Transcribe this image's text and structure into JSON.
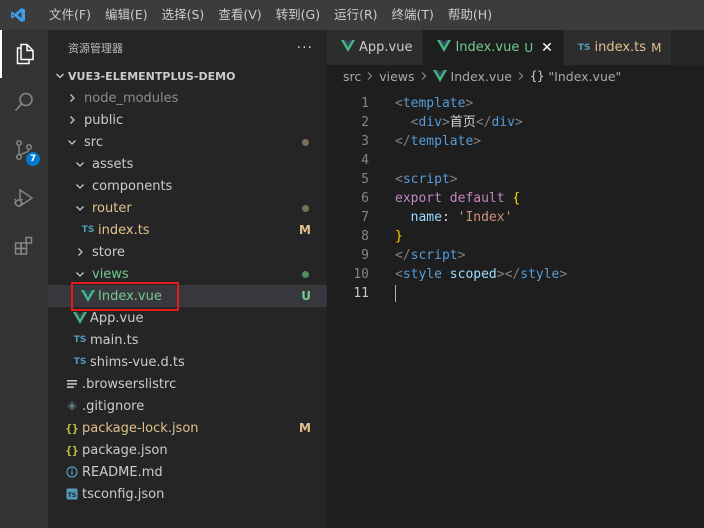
{
  "menu": [
    "文件(F)",
    "编辑(E)",
    "选择(S)",
    "查看(V)",
    "转到(G)",
    "运行(R)",
    "终端(T)",
    "帮助(H)"
  ],
  "activity": {
    "scm_badge": "7"
  },
  "sidebar": {
    "title": "资源管理器",
    "more": "···",
    "root": "VUE3-ELEMENTPLUS-DEMO",
    "items": [
      {
        "label": "node_modules",
        "chev": "right",
        "indent": 1,
        "icon": "",
        "color": "dim",
        "status": "",
        "dot": ""
      },
      {
        "label": "public",
        "chev": "right",
        "indent": 1,
        "icon": "",
        "color": "default",
        "status": "",
        "dot": ""
      },
      {
        "label": "src",
        "chev": "down",
        "indent": 1,
        "icon": "",
        "color": "default",
        "status": "",
        "dot": "#7b6e5b"
      },
      {
        "label": "assets",
        "chev": "down",
        "indent": 2,
        "icon": "",
        "color": "default",
        "status": "",
        "dot": ""
      },
      {
        "label": "components",
        "chev": "down",
        "indent": 2,
        "icon": "",
        "color": "default",
        "status": "",
        "dot": ""
      },
      {
        "label": "router",
        "chev": "down",
        "indent": 2,
        "icon": "",
        "color": "mod",
        "status": "",
        "dot": "#7b6e5b"
      },
      {
        "label": "index.ts",
        "chev": "",
        "indent": 3,
        "icon": "TS",
        "color": "mod",
        "status": "M",
        "dot": ""
      },
      {
        "label": "store",
        "chev": "right",
        "indent": 2,
        "icon": "",
        "color": "default",
        "status": "",
        "dot": ""
      },
      {
        "label": "views",
        "chev": "down",
        "indent": 2,
        "icon": "",
        "color": "new",
        "status": "",
        "dot": "#4e8e5c"
      },
      {
        "label": "Index.vue",
        "chev": "",
        "indent": 3,
        "icon": "vue",
        "color": "new",
        "status": "U",
        "dot": "",
        "selected": true
      },
      {
        "label": "App.vue",
        "chev": "",
        "indent": 2,
        "icon": "vue",
        "color": "default",
        "status": "",
        "dot": ""
      },
      {
        "label": "main.ts",
        "chev": "",
        "indent": 2,
        "icon": "TS",
        "color": "default",
        "status": "",
        "dot": ""
      },
      {
        "label": "shims-vue.d.ts",
        "chev": "",
        "indent": 2,
        "icon": "TS",
        "color": "default",
        "status": "",
        "dot": ""
      },
      {
        "label": ".browserslistrc",
        "chev": "",
        "indent": 1,
        "icon": "list",
        "color": "default",
        "status": "",
        "dot": ""
      },
      {
        "label": ".gitignore",
        "chev": "",
        "indent": 1,
        "icon": "git",
        "color": "default",
        "status": "",
        "dot": ""
      },
      {
        "label": "package-lock.json",
        "chev": "",
        "indent": 1,
        "icon": "{}",
        "color": "mod",
        "status": "M",
        "dot": ""
      },
      {
        "label": "package.json",
        "chev": "",
        "indent": 1,
        "icon": "{}",
        "color": "default",
        "status": "",
        "dot": ""
      },
      {
        "label": "README.md",
        "chev": "",
        "indent": 1,
        "icon": "info",
        "color": "default",
        "status": "",
        "dot": ""
      },
      {
        "label": "tsconfig.json",
        "chev": "",
        "indent": 1,
        "icon": "tsbox",
        "color": "default",
        "status": "",
        "dot": ""
      }
    ]
  },
  "tabs": [
    {
      "label": "App.vue",
      "icon": "vue",
      "status": "",
      "active": false,
      "color": "default"
    },
    {
      "label": "Index.vue",
      "icon": "vue",
      "status": "U",
      "active": true,
      "color": "new",
      "close": "✕"
    },
    {
      "label": "index.ts",
      "icon": "TS",
      "status": "M",
      "active": false,
      "color": "mod"
    }
  ],
  "breadcrumbs": {
    "parts": [
      "src",
      "views",
      "Index.vue",
      "\"Index.vue\""
    ],
    "object_icon": "{}"
  },
  "code": {
    "current_line": 11,
    "lines": [
      [
        [
          "t-br",
          "<"
        ],
        [
          "t-tag",
          "template"
        ],
        [
          "t-br",
          ">"
        ]
      ],
      [
        [
          "t-plain",
          "  "
        ],
        [
          "t-br",
          "<"
        ],
        [
          "t-tag",
          "div"
        ],
        [
          "t-br",
          ">"
        ],
        [
          "t-plain",
          "首页"
        ],
        [
          "t-br",
          "</"
        ],
        [
          "t-tag",
          "div"
        ],
        [
          "t-br",
          ">"
        ]
      ],
      [
        [
          "t-br",
          "</"
        ],
        [
          "t-tag",
          "template"
        ],
        [
          "t-br",
          ">"
        ]
      ],
      [],
      [
        [
          "t-br",
          "<"
        ],
        [
          "t-tag",
          "script"
        ],
        [
          "t-br",
          ">"
        ]
      ],
      [
        [
          "t-kw",
          "export"
        ],
        [
          "t-plain",
          " "
        ],
        [
          "t-kw",
          "default"
        ],
        [
          "t-plain",
          " "
        ],
        [
          "t-brace",
          "{"
        ]
      ],
      [
        [
          "t-plain",
          "  "
        ],
        [
          "t-prop",
          "name"
        ],
        [
          "t-plain",
          ": "
        ],
        [
          "t-str",
          "'Index'"
        ]
      ],
      [
        [
          "t-brace",
          "}"
        ]
      ],
      [
        [
          "t-br",
          "</"
        ],
        [
          "t-tag",
          "script"
        ],
        [
          "t-br",
          ">"
        ]
      ],
      [
        [
          "t-br",
          "<"
        ],
        [
          "t-tag",
          "style"
        ],
        [
          "t-plain",
          " "
        ],
        [
          "t-attr",
          "scoped"
        ],
        [
          "t-br",
          "></"
        ],
        [
          "t-tag",
          "style"
        ],
        [
          "t-br",
          ">"
        ]
      ],
      []
    ]
  }
}
